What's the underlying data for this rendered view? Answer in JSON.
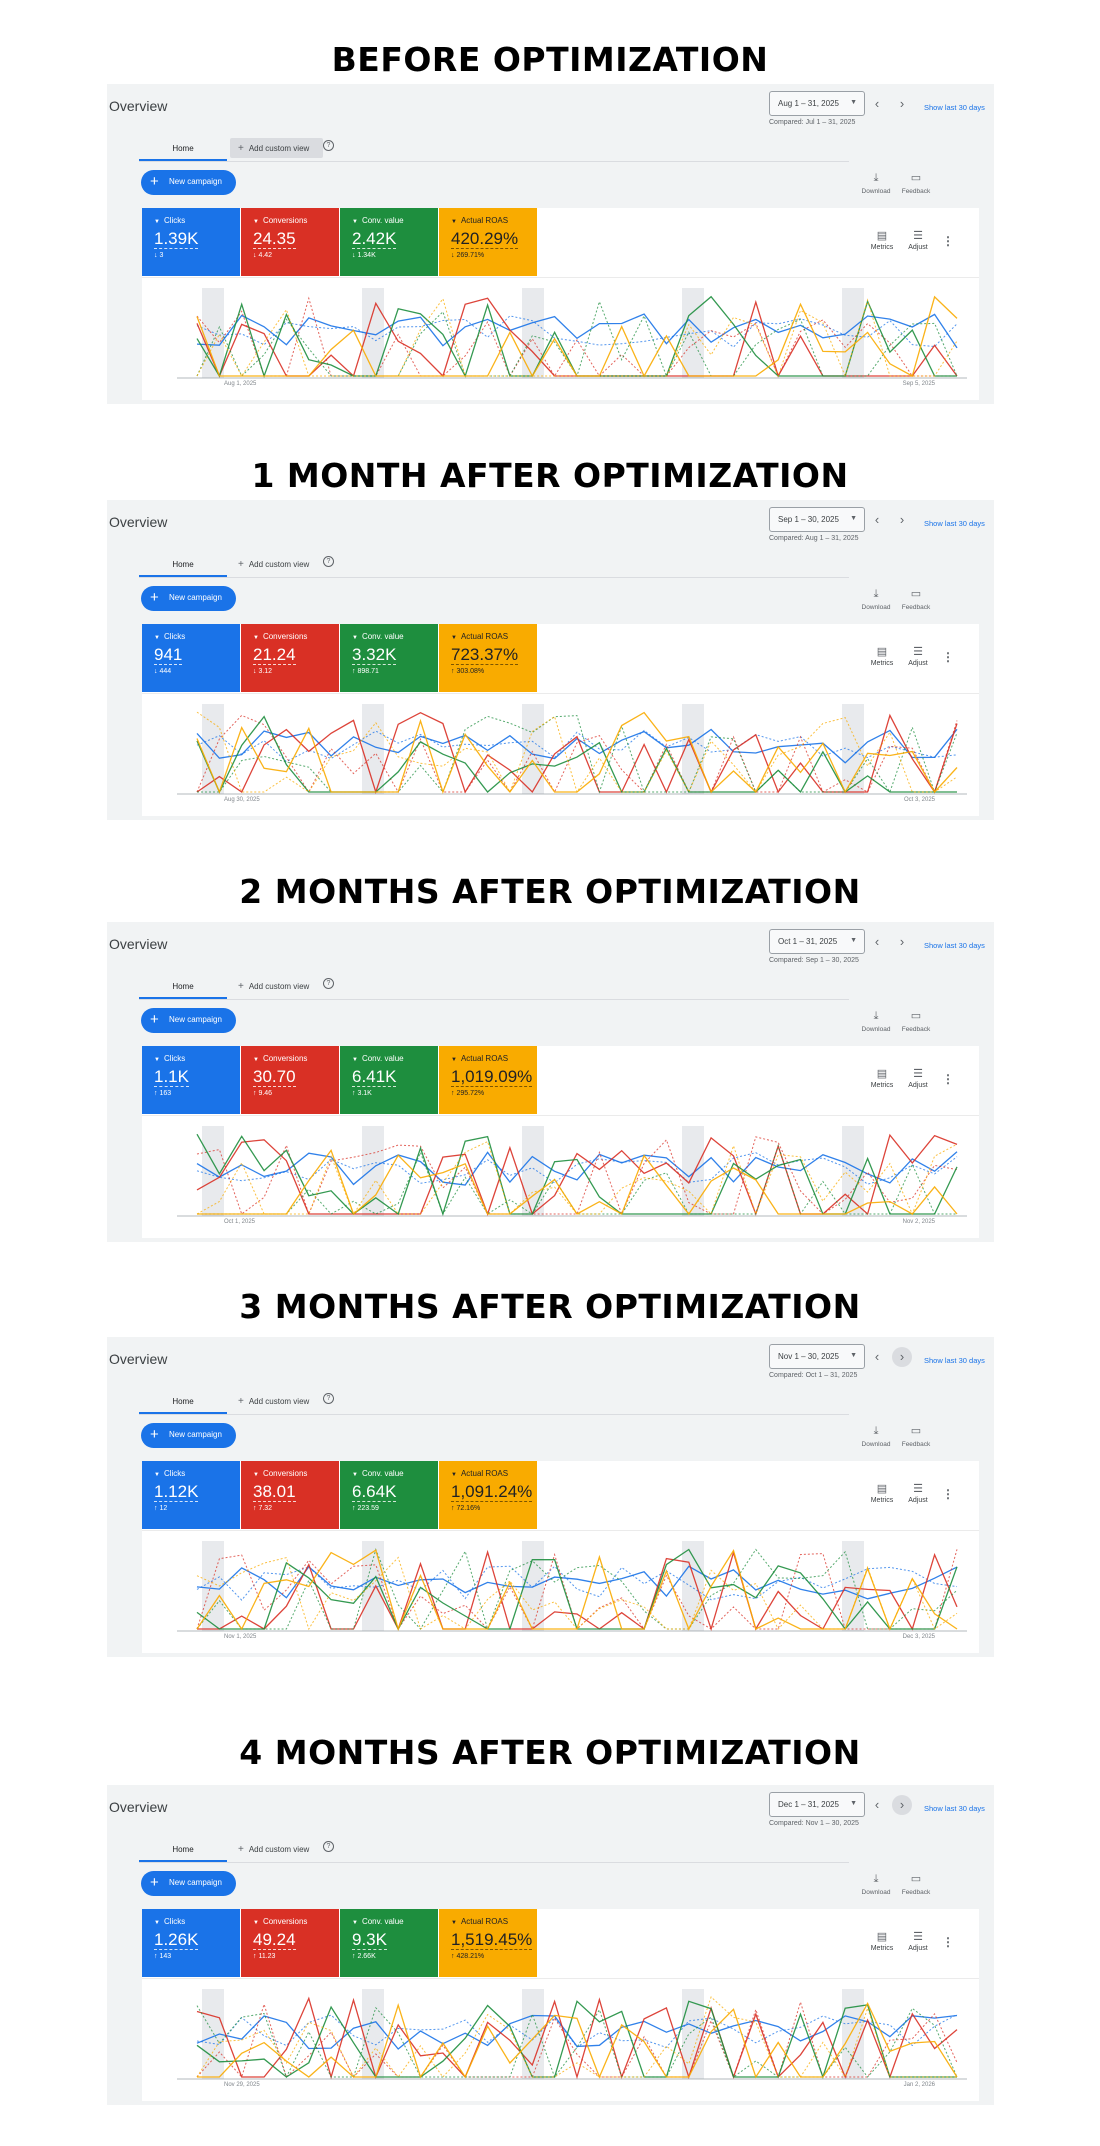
{
  "colors": {
    "clicks": "#1a73e8",
    "conversions": "#d93025",
    "conv_value": "#1e8e3e",
    "roas": "#f9ab00",
    "link": "#1a73e8",
    "panel_bg": "#f1f3f4"
  },
  "common": {
    "overview": "Overview",
    "show_last": "Show last 30 days",
    "tab_home": "Home",
    "tab_custom": "Add custom view",
    "new_campaign": "New campaign",
    "download": "Download",
    "feedback": "Feedback",
    "metrics": "Metrics",
    "adjust": "Adjust",
    "metric_names": {
      "clicks": "Clicks",
      "conversions": "Conversions",
      "conv_value": "Conv. value",
      "roas": "Actual ROAS"
    },
    "icons": {
      "plus": "add-icon",
      "help": "help-icon",
      "download": "download-icon",
      "feedback": "feedback-icon",
      "metrics": "metrics-icon",
      "adjust": "tune-icon",
      "more": "more-vert-icon",
      "prev": "chevron-left-icon",
      "next": "chevron-right-icon",
      "dropdown": "caret-down-icon"
    }
  },
  "sections": [
    {
      "heading": "BEFORE OPTIMIZATION",
      "date_range": "Aug 1 – 31, 2025",
      "compared": "Compared: Jul 1 – 31, 2025",
      "metrics": {
        "clicks": {
          "value": "1.39K",
          "delta": "↓ 3"
        },
        "conversions": {
          "value": "24.35",
          "delta": "↓ 4.42"
        },
        "conv_value": {
          "value": "2.42K",
          "delta": "↓ 1.34K"
        },
        "roas": {
          "value": "420.29%",
          "delta": "↓ 269.71%"
        }
      },
      "axis_start": "Aug 1, 2025",
      "axis_end": "Sep 5, 2025",
      "nav_highlight": false,
      "custom_tab_highlight": true
    },
    {
      "heading": "1 MONTH AFTER OPTIMIZATION",
      "date_range": "Sep 1 – 30, 2025",
      "compared": "Compared: Aug 1 – 31, 2025",
      "metrics": {
        "clicks": {
          "value": "941",
          "delta": "↓ 444"
        },
        "conversions": {
          "value": "21.24",
          "delta": "↓ 3.12"
        },
        "conv_value": {
          "value": "3.32K",
          "delta": "↑ 898.71"
        },
        "roas": {
          "value": "723.37%",
          "delta": "↑ 303.08%"
        }
      },
      "axis_start": "Aug 30, 2025",
      "axis_end": "Oct 3, 2025",
      "nav_highlight": false,
      "custom_tab_highlight": false
    },
    {
      "heading": "2 MONTHS AFTER OPTIMIZATION",
      "date_range": "Oct 1 – 31, 2025",
      "compared": "Compared: Sep 1 – 30, 2025",
      "metrics": {
        "clicks": {
          "value": "1.1K",
          "delta": "↑ 163"
        },
        "conversions": {
          "value": "30.70",
          "delta": "↑ 9.46"
        },
        "conv_value": {
          "value": "6.41K",
          "delta": "↑ 3.1K"
        },
        "roas": {
          "value": "1,019.09%",
          "delta": "↑ 295.72%"
        }
      },
      "axis_start": "Oct 1, 2025",
      "axis_end": "Nov 2, 2025",
      "nav_highlight": false,
      "custom_tab_highlight": false
    },
    {
      "heading": "3 MONTHS AFTER OPTIMIZATION",
      "date_range": "Nov 1 – 30, 2025",
      "compared": "Compared: Oct 1 – 31, 2025",
      "metrics": {
        "clicks": {
          "value": "1.12K",
          "delta": "↑ 12"
        },
        "conversions": {
          "value": "38.01",
          "delta": "↑ 7.32"
        },
        "conv_value": {
          "value": "6.64K",
          "delta": "↑ 223.59"
        },
        "roas": {
          "value": "1,091.24%",
          "delta": "↑ 72.16%"
        }
      },
      "axis_start": "Nov 1, 2025",
      "axis_end": "Dec 3, 2025",
      "nav_highlight": true,
      "custom_tab_highlight": false
    },
    {
      "heading": "4 MONTHS AFTER OPTIMIZATION",
      "date_range": "Dec 1 – 31, 2025",
      "compared": "Compared: Nov 1 – 30, 2025",
      "metrics": {
        "clicks": {
          "value": "1.26K",
          "delta": "↑ 143"
        },
        "conversions": {
          "value": "49.24",
          "delta": "↑ 11.23"
        },
        "conv_value": {
          "value": "9.3K",
          "delta": "↑ 2.66K"
        },
        "roas": {
          "value": "1,519.45%",
          "delta": "↑ 428.21%"
        }
      },
      "axis_start": "Nov 29, 2025",
      "axis_end": "Jan 2, 2026",
      "nav_highlight": true,
      "custom_tab_highlight": false
    }
  ]
}
